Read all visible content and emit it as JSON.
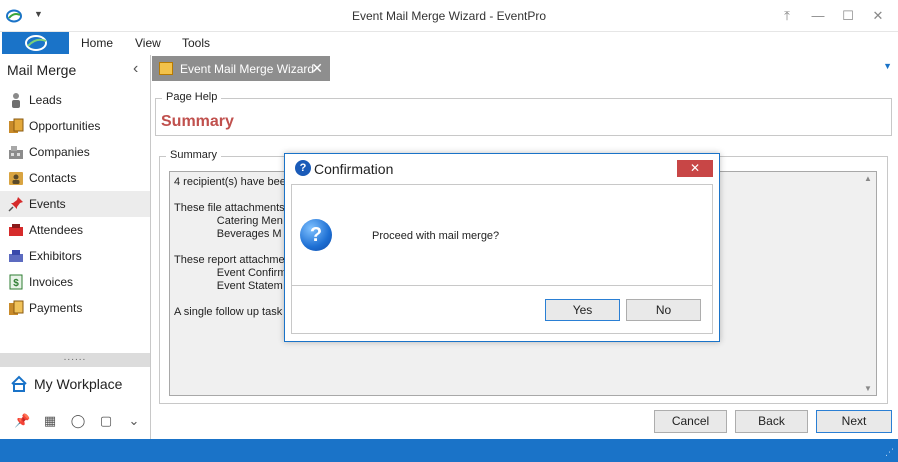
{
  "window": {
    "title": "Event Mail Merge Wizard - EventPro",
    "controls": [
      "restore-icon",
      "minimize-icon",
      "maximize-icon",
      "close-icon"
    ]
  },
  "menu": {
    "home": "Home",
    "view": "View",
    "tools": "Tools"
  },
  "sidebar": {
    "title": "Mail Merge",
    "items": [
      {
        "label": "Leads",
        "icon": "person-icon"
      },
      {
        "label": "Opportunities",
        "icon": "opportunities-icon"
      },
      {
        "label": "Companies",
        "icon": "companies-icon"
      },
      {
        "label": "Contacts",
        "icon": "contact-card-icon"
      },
      {
        "label": "Events",
        "icon": "pushpin-icon"
      },
      {
        "label": "Attendees",
        "icon": "attendees-icon"
      },
      {
        "label": "Exhibitors",
        "icon": "exhibitors-icon"
      },
      {
        "label": "Invoices",
        "icon": "invoice-icon"
      },
      {
        "label": "Payments",
        "icon": "payments-icon"
      }
    ],
    "splitter": "......",
    "workplace": "My Workplace"
  },
  "tab": {
    "label": "Event Mail Merge Wizard"
  },
  "page": {
    "page_help_legend": "Page Help",
    "heading": "Summary",
    "summary_legend": "Summary",
    "summary_text": "4 recipient(s) have bee\n\nThese file attachments\n              Catering Men\n              Beverages M\n\nThese report attachmen\n              Event Confirm\n              Event Statem\n\nA single follow up task w"
  },
  "buttons": {
    "cancel": "Cancel",
    "back": "Back",
    "next": "Next"
  },
  "dialog": {
    "title": "Confirmation",
    "message": "Proceed with mail merge?",
    "yes": "Yes",
    "no": "No",
    "close": "✕"
  },
  "colors": {
    "accent": "#1a73c8",
    "heading": "#c0504d",
    "close_red": "#c84646"
  }
}
